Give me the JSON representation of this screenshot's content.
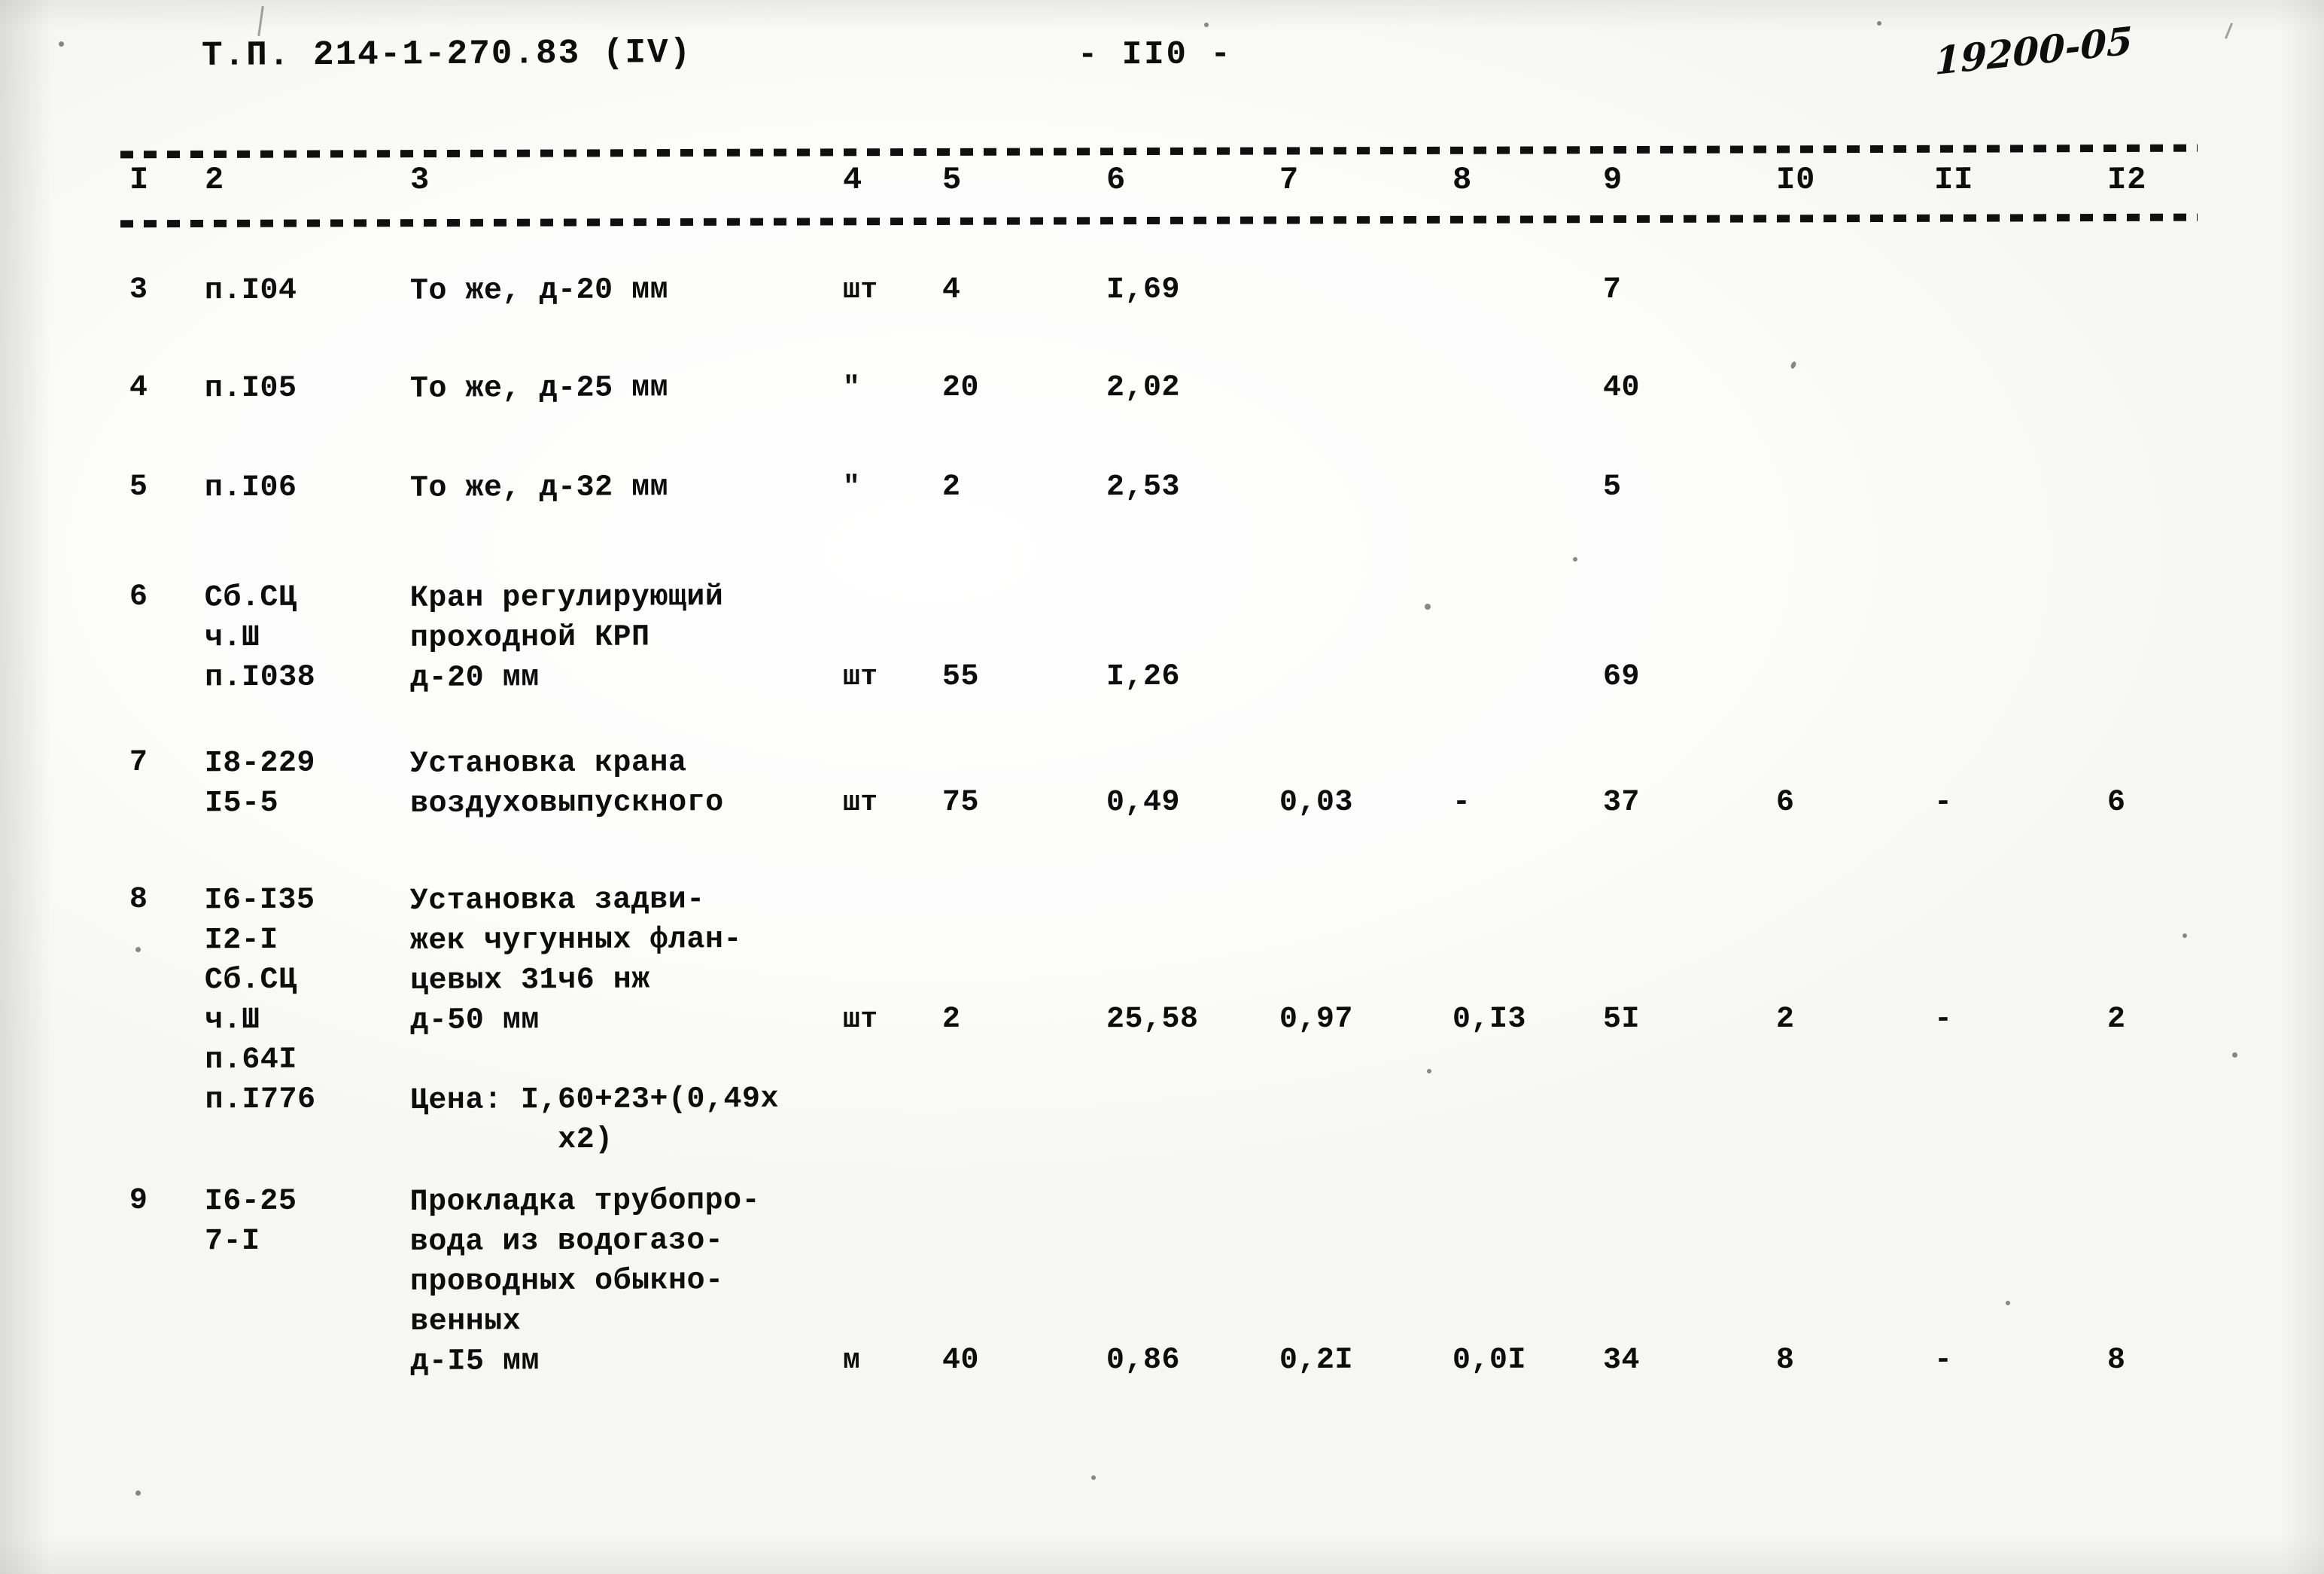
{
  "header": {
    "doc_code": "Т.П. 214-1-270.83 (IV)",
    "page_number": "- II0 -",
    "hand_number": "19200-05"
  },
  "table": {
    "column_headers": [
      "I",
      "2",
      "3",
      "4",
      "5",
      "6",
      "7",
      "8",
      "9",
      "I0",
      "II",
      "I2"
    ],
    "rows": [
      {
        "num": "3",
        "codes": "п.I04",
        "desc": "То же, д-20 мм",
        "unit": "шт",
        "qty": "4",
        "c6": "I,69",
        "c7": "",
        "c8": "",
        "c9": "7",
        "c10": "",
        "c11": "",
        "c12": ""
      },
      {
        "num": "4",
        "codes": "п.I05",
        "desc": "То же, д-25 мм",
        "unit": "\"",
        "qty": "20",
        "c6": "2,02",
        "c7": "",
        "c8": "",
        "c9": "40",
        "c10": "",
        "c11": "",
        "c12": ""
      },
      {
        "num": "5",
        "codes": "п.I06",
        "desc": "То же, д-32 мм",
        "unit": "\"",
        "qty": "2",
        "c6": "2,53",
        "c7": "",
        "c8": "",
        "c9": "5",
        "c10": "",
        "c11": "",
        "c12": ""
      },
      {
        "num": "6",
        "codes": "Сб.СЦ\nч.Ш\nп.I038",
        "desc": "Кран регулирующий\nпроходной КРП\nд-20 мм",
        "unit": "шт",
        "qty": "55",
        "c6": "I,26",
        "c7": "",
        "c8": "",
        "c9": "69",
        "c10": "",
        "c11": "",
        "c12": ""
      },
      {
        "num": "7",
        "codes": "I8-229\nI5-5",
        "desc": "Установка крана\nвоздуховыпускного",
        "unit": "шт",
        "qty": "75",
        "c6": "0,49",
        "c7": "0,03",
        "c8": "-",
        "c9": "37",
        "c10": "6",
        "c11": "-",
        "c12": "6"
      },
      {
        "num": "8",
        "codes": "I6-I35\nI2-I\nСб.СЦ\nч.Ш\nп.64I\nп.I776",
        "desc": "Установка задви-\nжек чугунных флан-\nцевых 31ч6 нж\nд-50 мм",
        "desc_extra": "Цена: I,60+23+(0,49х\n        х2)",
        "unit": "шт",
        "qty": "2",
        "c6": "25,58",
        "c7": "0,97",
        "c8": "0,I3",
        "c9": "5I",
        "c10": "2",
        "c11": "-",
        "c12": "2"
      },
      {
        "num": "9",
        "codes": "I6-25\n7-I",
        "desc": "Прокладка трубопро-\nвода из водогазо-\nпроводных обыкно-\nвенных\nд-I5 мм",
        "unit": "м",
        "qty": "40",
        "c6": "0,86",
        "c7": "0,2I",
        "c8": "0,0I",
        "c9": "34",
        "c10": "8",
        "c11": "-",
        "c12": "8"
      }
    ]
  }
}
